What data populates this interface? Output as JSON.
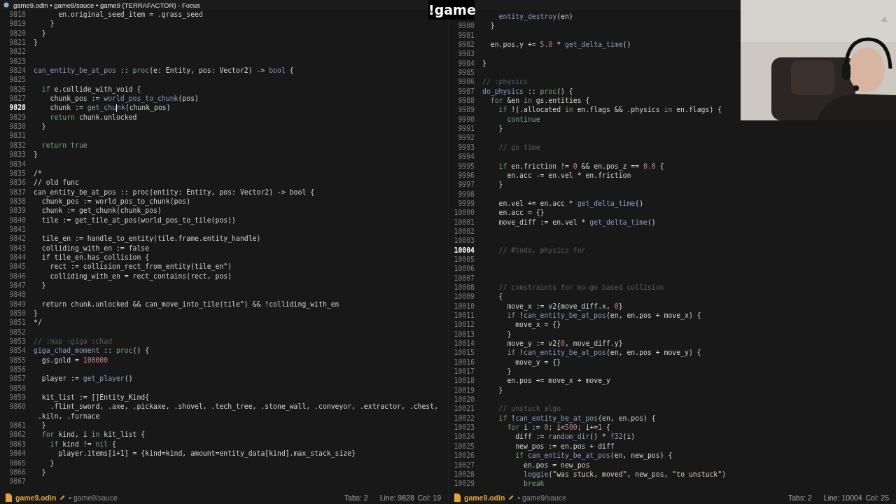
{
  "window": {
    "title": "game9.odin • game9/sauce • game9 (TERRAFACTOR) - Focus"
  },
  "overlay": {
    "logo": "!game"
  },
  "panes": [
    {
      "lines": [
        {
          "number": "9818",
          "current": false,
          "tokens": [
            "      en.original_seed_item = .grass_seed"
          ]
        },
        {
          "number": "9819",
          "current": false,
          "tokens": [
            "    }"
          ]
        },
        {
          "number": "9820",
          "current": false,
          "tokens": [
            "  }"
          ]
        },
        {
          "number": "9821",
          "current": false,
          "tokens": [
            "}"
          ]
        },
        {
          "number": "9822",
          "current": false
        },
        {
          "number": "9823",
          "current": false
        },
        {
          "number": "9824",
          "current": false,
          "tokens": [
            {
              "text": "can_entity_be_at_pos",
              "kind": "fn"
            },
            " :: ",
            {
              "text": "proc",
              "kind": "kw"
            },
            "(e: Entity, pos: Vector2) -> ",
            {
              "text": "bool",
              "kind": "fn"
            },
            " {"
          ]
        },
        {
          "number": "9825",
          "current": false
        },
        {
          "number": "9826",
          "current": false,
          "tokens": [
            {
              "text": "  if",
              "kind": "kw"
            },
            " e.collide_with_void {"
          ]
        },
        {
          "number": "9827",
          "current": false,
          "tokens": [
            "    chunk_pos := ",
            {
              "text": "world_pos_to_chunk",
              "kind": "fn"
            },
            "(pos)"
          ]
        },
        {
          "number": "9828",
          "current": true,
          "tokens": [
            "    chunk := ",
            {
              "text": "get_chu",
              "kind": "fn"
            }
          ],
          "after_caret": [
            {
              "text": "nk",
              "kind": "fn"
            },
            "(chunk_pos)"
          ]
        },
        {
          "number": "9829",
          "current": false,
          "tokens": [
            {
              "text": "    return",
              "kind": "kw"
            },
            " chunk.unlocked"
          ]
        },
        {
          "number": "9830",
          "current": false,
          "tokens": [
            "  }"
          ]
        },
        {
          "number": "9831",
          "current": false
        },
        {
          "number": "9832",
          "current": false,
          "tokens": [
            {
              "text": "  return true",
              "kind": "kw"
            }
          ]
        },
        {
          "number": "9833",
          "current": false,
          "tokens": [
            "}"
          ]
        },
        {
          "number": "9834",
          "current": false
        },
        {
          "number": "9835",
          "current": false,
          "tokens": [
            "/*"
          ]
        },
        {
          "number": "9836",
          "current": false,
          "tokens": [
            "// old func"
          ]
        },
        {
          "number": "9837",
          "current": false,
          "tokens": [
            "can_entity_be_at_pos :: proc(entity: Entity, pos: Vector2) -> bool {"
          ]
        },
        {
          "number": "9838",
          "current": false,
          "tokens": [
            "  chunk_pos := world_pos_to_chunk(pos)"
          ]
        },
        {
          "number": "9839",
          "current": false,
          "tokens": [
            "  chunk := get_chunk(chunk_pos)"
          ]
        },
        {
          "number": "9840",
          "current": false,
          "tokens": [
            "  tile := get_tile_at_pos(world_pos_to_tile(pos))"
          ]
        },
        {
          "number": "9841",
          "current": false
        },
        {
          "number": "9842",
          "current": false,
          "tokens": [
            "  tile_en := handle_to_entity(tile.frame.entity_handle)"
          ]
        },
        {
          "number": "9843",
          "current": false,
          "tokens": [
            "  colliding_with_en := false"
          ]
        },
        {
          "number": "9844",
          "current": false,
          "tokens": [
            "  if tile_en.has_collision {"
          ]
        },
        {
          "number": "9845",
          "current": false,
          "tokens": [
            "    rect := collision_rect_from_entity(tile_en^)"
          ]
        },
        {
          "number": "9846",
          "current": false,
          "tokens": [
            "    colliding_with_en = rect_contains(rect, pos)"
          ]
        },
        {
          "number": "9847",
          "current": false,
          "tokens": [
            "  }"
          ]
        },
        {
          "number": "9848",
          "current": false
        },
        {
          "number": "9849",
          "current": false,
          "tokens": [
            "  return chunk.unlocked && can_move_into_tile(tile^) && !colliding_with_en"
          ]
        },
        {
          "number": "9850",
          "current": false,
          "tokens": [
            "}"
          ]
        },
        {
          "number": "9851",
          "current": false,
          "tokens": [
            "*/"
          ]
        },
        {
          "number": "9852",
          "current": false
        },
        {
          "number": "9853",
          "current": false,
          "tokens": [
            {
              "text": "// :map :giga :chad",
              "kind": "com"
            }
          ]
        },
        {
          "number": "9854",
          "current": false,
          "tokens": [
            {
              "text": "giga_chad_moment",
              "kind": "fn"
            },
            " :: ",
            {
              "text": "proc",
              "kind": "kw"
            },
            "() {"
          ]
        },
        {
          "number": "9855",
          "current": false,
          "tokens": [
            "  gs.gold = ",
            {
              "text": "100000",
              "kind": "num"
            }
          ]
        },
        {
          "number": "9856",
          "current": false
        },
        {
          "number": "9857",
          "current": false,
          "tokens": [
            "  player := ",
            {
              "text": "get_player",
              "kind": "fn"
            },
            "()"
          ]
        },
        {
          "number": "9858",
          "current": false
        },
        {
          "number": "9859",
          "current": false,
          "tokens": [
            "  kit_list := []Entity_Kind{"
          ]
        },
        {
          "number": "9860",
          "current": false,
          "tokens": [
            "    .flint_sword, .axe, .pickaxe, .shovel, .tech_tree, .stone_wall, .conveyor, .extractor, .chest,"
          ]
        },
        {
          "tokens": [
            " .kiln, .furnace"
          ]
        },
        {
          "number": "9861",
          "current": false,
          "tokens": [
            "  }"
          ]
        },
        {
          "number": "9862",
          "current": false,
          "tokens": [
            {
              "text": "  for",
              "kind": "kw"
            },
            " kind, i ",
            {
              "text": "in",
              "kind": "kw"
            },
            " kit_list {"
          ]
        },
        {
          "number": "9863",
          "current": false,
          "tokens": [
            {
              "text": "    if",
              "kind": "kw"
            },
            " kind != ",
            {
              "text": "nil",
              "kind": "kw"
            },
            " {"
          ]
        },
        {
          "number": "9864",
          "current": false,
          "tokens": [
            "      player.items[i+1] = {kind=kind, amount=entity_data[kind].max_stack_size}"
          ]
        },
        {
          "number": "9865",
          "current": false,
          "tokens": [
            "    }"
          ]
        },
        {
          "number": "9866",
          "current": false,
          "tokens": [
            "  }"
          ]
        },
        {
          "number": "9867",
          "current": false
        }
      ],
      "status_bar": {
        "file": "game9.odin",
        "path": "• game9/sauce",
        "tabs": "Tabs: 2",
        "line": "Line: 9828",
        "col": "Col: 19"
      }
    },
    {
      "lines": [
        {
          "tokens": [
            {
              "text": "    entity_destroy",
              "kind": "fn"
            },
            "(en)"
          ]
        },
        {
          "number": "9980",
          "current": false,
          "tokens": [
            "  }"
          ]
        },
        {
          "number": "9981",
          "current": false
        },
        {
          "number": "9982",
          "current": false,
          "tokens": [
            "  en.pos.y += ",
            {
              "text": "5.0",
              "kind": "num"
            },
            " * ",
            {
              "text": "get_delta_time",
              "kind": "fn"
            },
            "()"
          ]
        },
        {
          "number": "9983",
          "current": false
        },
        {
          "number": "9984",
          "current": false,
          "tokens": [
            "}"
          ]
        },
        {
          "number": "9985",
          "current": false
        },
        {
          "number": "9986",
          "current": false,
          "tokens": [
            {
              "text": "// :physics",
              "kind": "com"
            }
          ]
        },
        {
          "number": "9987",
          "current": false,
          "tokens": [
            {
              "text": "do_physics",
              "kind": "fn"
            },
            " :: ",
            {
              "text": "proc",
              "kind": "kw"
            },
            "() {"
          ]
        },
        {
          "number": "9988",
          "current": false,
          "tokens": [
            {
              "text": "  for",
              "kind": "kw"
            },
            " &en ",
            {
              "text": "in",
              "kind": "kw"
            },
            " gs.entities {"
          ]
        },
        {
          "number": "9989",
          "current": false,
          "tokens": [
            {
              "text": "    if",
              "kind": "kw"
            },
            " !(.allocated ",
            {
              "text": "in",
              "kind": "kw"
            },
            " en.flags && .physics ",
            {
              "text": "in",
              "kind": "kw"
            },
            " en.flags) {"
          ]
        },
        {
          "number": "9990",
          "current": false,
          "tokens": [
            {
              "text": "      continue",
              "kind": "kw"
            }
          ]
        },
        {
          "number": "9991",
          "current": false,
          "tokens": [
            "    }"
          ]
        },
        {
          "number": "9992",
          "current": false
        },
        {
          "number": "9993",
          "current": false,
          "tokens": [
            {
              "text": "    // go time",
              "kind": "com"
            }
          ]
        },
        {
          "number": "9994",
          "current": false
        },
        {
          "number": "9995",
          "current": false,
          "tokens": [
            {
              "text": "    if",
              "kind": "kw"
            },
            " en.friction != ",
            {
              "text": "0",
              "kind": "num"
            },
            " && en.pos_z == ",
            {
              "text": "0.0",
              "kind": "num"
            },
            " {"
          ]
        },
        {
          "number": "9996",
          "current": false,
          "tokens": [
            "      en.acc -= en.vel * en.friction"
          ]
        },
        {
          "number": "9997",
          "current": false,
          "tokens": [
            "    }"
          ]
        },
        {
          "number": "9998",
          "current": false
        },
        {
          "number": "9999",
          "current": false,
          "tokens": [
            "    en.vel += en.acc * ",
            {
              "text": "get_delta_time",
              "kind": "fn"
            },
            "()"
          ]
        },
        {
          "number": "10000",
          "current": false,
          "tokens": [
            "    en.acc = {}"
          ]
        },
        {
          "number": "10001",
          "current": false,
          "tokens": [
            "    move_diff := en.vel * ",
            {
              "text": "get_delta_time",
              "kind": "fn"
            },
            "()"
          ]
        },
        {
          "number": "10002",
          "current": false
        },
        {
          "number": "10003",
          "current": false
        },
        {
          "number": "10004",
          "current": true,
          "tokens": [
            {
              "text": "    // #todo, physics for",
              "kind": "com"
            }
          ]
        },
        {
          "number": "10005",
          "current": false
        },
        {
          "number": "10006",
          "current": false
        },
        {
          "number": "10007",
          "current": false
        },
        {
          "number": "10008",
          "current": false,
          "tokens": [
            {
              "text": "    // constraints for no-go based collision",
              "kind": "com"
            }
          ]
        },
        {
          "number": "10009",
          "current": false,
          "tokens": [
            "    {"
          ]
        },
        {
          "number": "10010",
          "current": false,
          "tokens": [
            "      move_x := v2{move_diff.x, ",
            {
              "text": "0",
              "kind": "num"
            },
            "}"
          ]
        },
        {
          "number": "10011",
          "current": false,
          "tokens": [
            {
              "text": "      if",
              "kind": "kw"
            },
            " !",
            {
              "text": "can_entity_be_at_pos",
              "kind": "fn"
            },
            "(en, en.pos + move_x) {"
          ]
        },
        {
          "number": "10012",
          "current": false,
          "tokens": [
            "        move_x = {}"
          ]
        },
        {
          "number": "10013",
          "current": false,
          "tokens": [
            "      }"
          ]
        },
        {
          "number": "10014",
          "current": false,
          "tokens": [
            "      move_y := v2{",
            {
              "text": "0",
              "kind": "num"
            },
            ", move_diff.y}"
          ]
        },
        {
          "number": "10015",
          "current": false,
          "tokens": [
            {
              "text": "      if",
              "kind": "kw"
            },
            " !",
            {
              "text": "can_entity_be_at_pos",
              "kind": "fn"
            },
            "(en, en.pos + move_y) {"
          ]
        },
        {
          "number": "10016",
          "current": false,
          "tokens": [
            "        move_y = {}"
          ]
        },
        {
          "number": "10017",
          "current": false,
          "tokens": [
            "      }"
          ]
        },
        {
          "number": "10018",
          "current": false,
          "tokens": [
            "      en.pos += move_x + move_y"
          ]
        },
        {
          "number": "10019",
          "current": false,
          "tokens": [
            "    }"
          ]
        },
        {
          "number": "10020",
          "current": false
        },
        {
          "number": "10021",
          "current": false,
          "tokens": [
            {
              "text": "    // unstuck algo",
              "kind": "com"
            }
          ]
        },
        {
          "number": "10022",
          "current": false,
          "tokens": [
            {
              "text": "    if",
              "kind": "kw"
            },
            " !",
            {
              "text": "can_entity_be_at_pos",
              "kind": "fn"
            },
            "(en, en.pos) {"
          ]
        },
        {
          "number": "10023",
          "current": false,
          "tokens": [
            {
              "text": "      for",
              "kind": "kw"
            },
            " i := ",
            {
              "text": "0",
              "kind": "num"
            },
            "; i<",
            {
              "text": "500",
              "kind": "num"
            },
            "; i+=",
            {
              "text": "1",
              "kind": "num"
            },
            " {"
          ]
        },
        {
          "number": "10024",
          "current": false,
          "tokens": [
            "        diff := ",
            {
              "text": "random_dir",
              "kind": "fn"
            },
            "() * ",
            {
              "text": "f32",
              "kind": "fn"
            },
            "(i)"
          ]
        },
        {
          "number": "10025",
          "current": false,
          "tokens": [
            "        new_pos := en.pos + diff"
          ]
        },
        {
          "number": "10026",
          "current": false,
          "tokens": [
            {
              "text": "        if",
              "kind": "kw"
            },
            {
              "text": " can_entity_be_at_pos",
              "kind": "fn"
            },
            "(en, new_pos) {"
          ]
        },
        {
          "number": "10027",
          "current": false,
          "tokens": [
            "          en.pos = new_pos"
          ]
        },
        {
          "number": "10028",
          "current": false,
          "tokens": [
            {
              "text": "          loggie",
              "kind": "fn"
            },
            "(",
            {
              "text": "\"was stuck, moved\"",
              "kind": "str"
            },
            ", new_pos, ",
            {
              "text": "\"to unstuck\"",
              "kind": "str"
            },
            ")"
          ]
        },
        {
          "number": "10029",
          "current": false,
          "tokens": [
            {
              "text": "          break",
              "kind": "kw"
            }
          ]
        }
      ],
      "status_bar": {
        "file": "game9.odin",
        "path": "• game9/sauce",
        "tabs": "Tabs: 2",
        "line": "Line: 10004",
        "col": "Col: 25"
      }
    }
  ]
}
